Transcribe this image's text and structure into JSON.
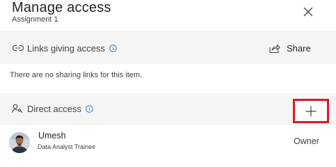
{
  "header": {
    "title": "Manage access",
    "subtitle": "Assignment 1",
    "close_icon": "close-icon"
  },
  "links_section": {
    "label": "Links giving access",
    "label_icon": "link-icon",
    "info_icon": "info-icon",
    "share_label": "Share",
    "share_icon": "share-icon",
    "empty_message": "There are no sharing links for this item."
  },
  "direct_section": {
    "label": "Direct access",
    "label_icon": "person-key-icon",
    "info_icon": "info-icon",
    "add_icon": "add-icon",
    "highlight_color": "#e8141f"
  },
  "members": [
    {
      "name": "Umesh",
      "role": "Data Analyst Trainee",
      "permission": "Owner",
      "avatar_icon": "avatar-photo"
    }
  ],
  "colors": {
    "section_bg": "#f5f5f5",
    "text_primary": "#242424",
    "text_secondary": "#424242",
    "accent_blue": "#0f6cbd"
  }
}
